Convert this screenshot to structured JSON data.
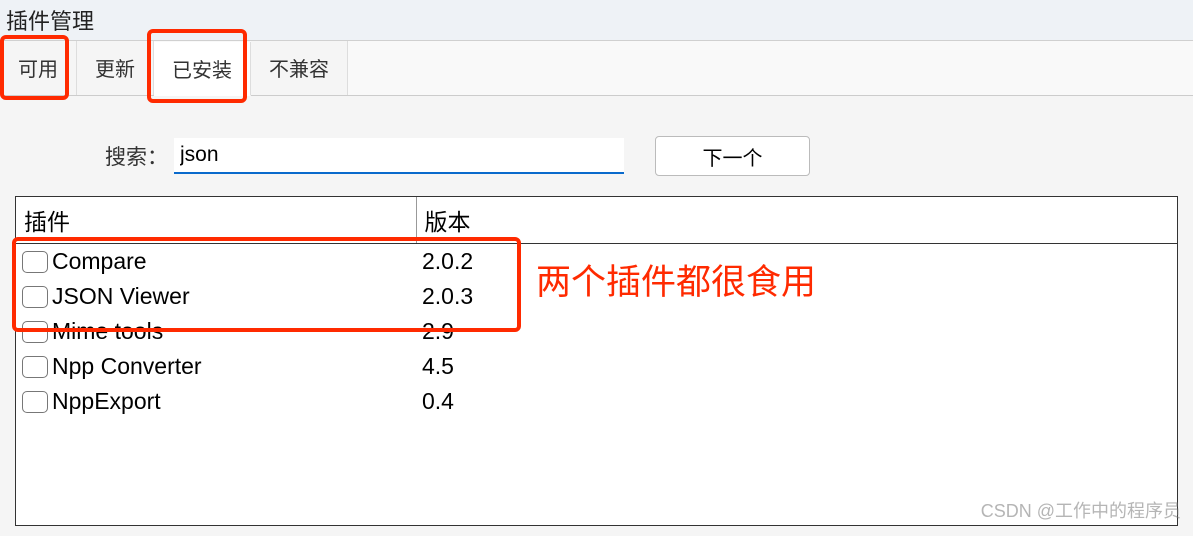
{
  "window": {
    "title": "插件管理"
  },
  "tabs": {
    "available": "可用",
    "update": "更新",
    "installed": "已安装",
    "incompatible": "不兼容"
  },
  "search": {
    "label": "搜索：",
    "value": "json",
    "next": "下一个"
  },
  "table": {
    "headers": {
      "plugin": "插件",
      "version": "版本"
    },
    "rows": [
      {
        "name": "Compare",
        "version": "2.0.2"
      },
      {
        "name": "JSON Viewer",
        "version": "2.0.3"
      },
      {
        "name": "Mime tools",
        "version": "2.9"
      },
      {
        "name": "Npp Converter",
        "version": "4.5"
      },
      {
        "name": "NppExport",
        "version": "0.4"
      }
    ]
  },
  "annotation": "两个插件都很食用",
  "watermark": "CSDN @工作中的程序员"
}
